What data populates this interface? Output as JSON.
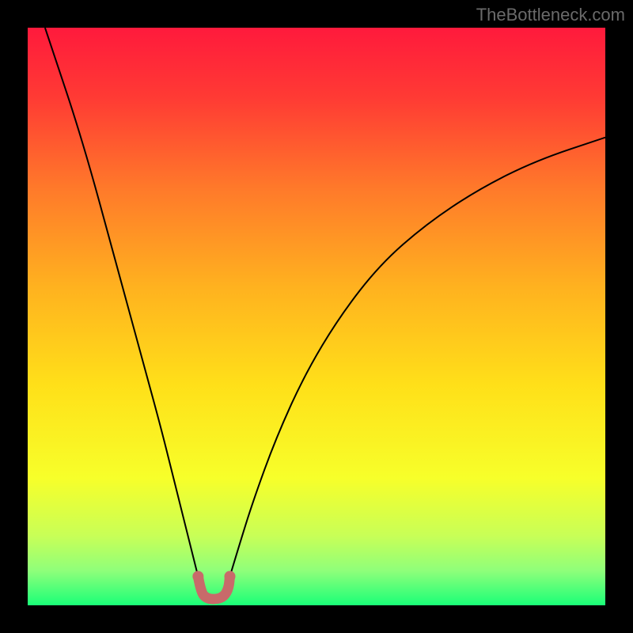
{
  "watermark": "TheBottleneck.com",
  "chart_data": {
    "type": "line",
    "title": "",
    "xlabel": "",
    "ylabel": "",
    "xlim": [
      0,
      100
    ],
    "ylim": [
      0,
      100
    ],
    "background_gradient": {
      "stops": [
        {
          "offset": 0.0,
          "color": "#ff1a3c"
        },
        {
          "offset": 0.12,
          "color": "#ff3a34"
        },
        {
          "offset": 0.28,
          "color": "#ff7a2a"
        },
        {
          "offset": 0.45,
          "color": "#ffb21f"
        },
        {
          "offset": 0.62,
          "color": "#ffe019"
        },
        {
          "offset": 0.78,
          "color": "#f7ff2a"
        },
        {
          "offset": 0.88,
          "color": "#c8ff57"
        },
        {
          "offset": 0.94,
          "color": "#8fff7a"
        },
        {
          "offset": 1.0,
          "color": "#1aff78"
        }
      ]
    },
    "series": [
      {
        "name": "left-branch",
        "comment": "Steep descending curve from top-left toward the minimum",
        "points": [
          {
            "x": 3.0,
            "y": 100.0
          },
          {
            "x": 5.0,
            "y": 94.0
          },
          {
            "x": 8.0,
            "y": 85.0
          },
          {
            "x": 11.0,
            "y": 75.0
          },
          {
            "x": 14.0,
            "y": 64.0
          },
          {
            "x": 17.0,
            "y": 53.0
          },
          {
            "x": 20.0,
            "y": 42.0
          },
          {
            "x": 23.0,
            "y": 31.0
          },
          {
            "x": 25.0,
            "y": 23.0
          },
          {
            "x": 27.0,
            "y": 15.0
          },
          {
            "x": 28.5,
            "y": 9.0
          },
          {
            "x": 29.5,
            "y": 5.0
          }
        ]
      },
      {
        "name": "right-branch",
        "comment": "Rising curve from the minimum toward the upper-right, flattening out",
        "points": [
          {
            "x": 35.0,
            "y": 5.0
          },
          {
            "x": 36.5,
            "y": 10.0
          },
          {
            "x": 39.0,
            "y": 18.0
          },
          {
            "x": 43.0,
            "y": 29.0
          },
          {
            "x": 48.0,
            "y": 40.0
          },
          {
            "x": 54.0,
            "y": 50.0
          },
          {
            "x": 61.0,
            "y": 59.0
          },
          {
            "x": 69.0,
            "y": 66.0
          },
          {
            "x": 78.0,
            "y": 72.0
          },
          {
            "x": 88.0,
            "y": 77.0
          },
          {
            "x": 100.0,
            "y": 81.0
          }
        ]
      },
      {
        "name": "minimum-marker",
        "comment": "Thick salmon-pink U-shaped marker at the valley floor",
        "color": "#c86a6a",
        "points": [
          {
            "x": 29.5,
            "y": 5.0
          },
          {
            "x": 30.0,
            "y": 2.2
          },
          {
            "x": 31.0,
            "y": 1.2
          },
          {
            "x": 32.5,
            "y": 1.0
          },
          {
            "x": 34.0,
            "y": 1.5
          },
          {
            "x": 34.8,
            "y": 3.0
          },
          {
            "x": 35.0,
            "y": 5.0
          }
        ]
      }
    ]
  }
}
